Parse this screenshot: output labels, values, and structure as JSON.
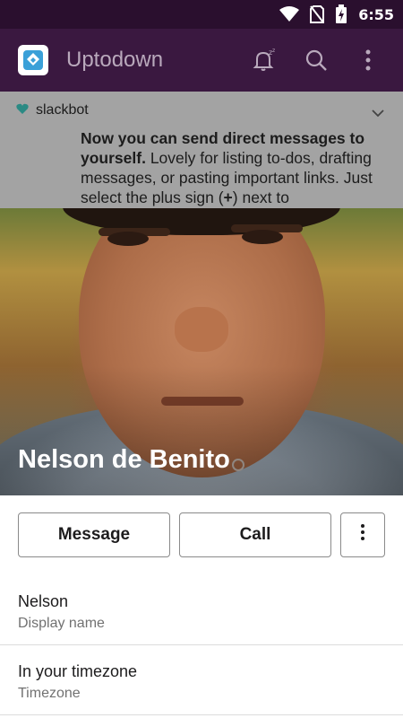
{
  "status_bar": {
    "time": "6:55",
    "icons": [
      "wifi-icon",
      "no-sim-icon",
      "battery-charging-icon"
    ]
  },
  "app_bar": {
    "workspace_name": "Uptodown",
    "icons": [
      "workspace-logo-icon",
      "snooze-bell-icon",
      "search-icon",
      "more-vertical-icon"
    ]
  },
  "background": {
    "channel_name": "slackbot",
    "message_bold": "Now you can send direct messages to yourself.",
    "message_text": " Lovely for listing to-dos, drafting messages, or pasting important links. Just select the plus sign (",
    "message_plus": "+",
    "message_tail": ") next to"
  },
  "profile": {
    "name": "Nelson de Benito"
  },
  "actions": {
    "message_label": "Message",
    "call_label": "Call",
    "more_icon": "more-vertical-icon"
  },
  "fields": [
    {
      "value": "Nelson",
      "label": "Display name"
    },
    {
      "value": "In your timezone",
      "label": "Timezone"
    }
  ]
}
